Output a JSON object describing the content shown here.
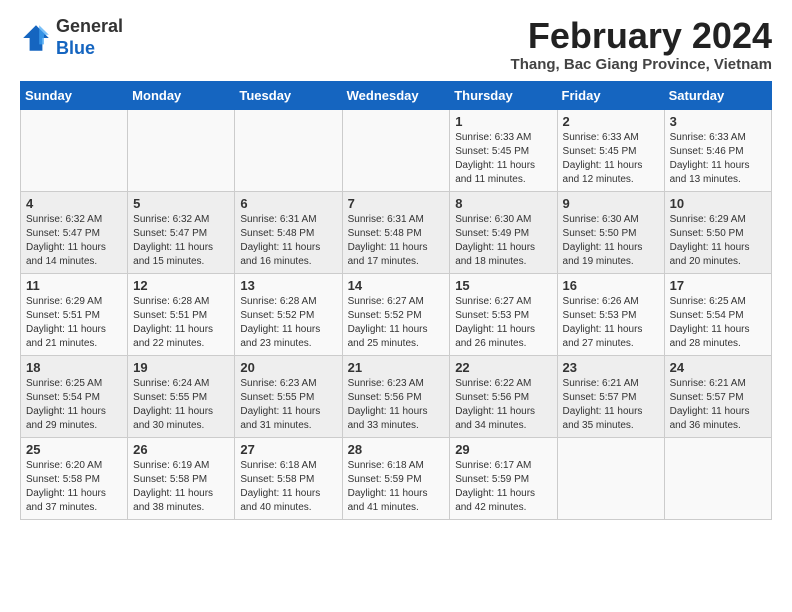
{
  "header": {
    "logo_general": "General",
    "logo_blue": "Blue",
    "month_year": "February 2024",
    "location": "Thang, Bac Giang Province, Vietnam"
  },
  "days_of_week": [
    "Sunday",
    "Monday",
    "Tuesday",
    "Wednesday",
    "Thursday",
    "Friday",
    "Saturday"
  ],
  "weeks": [
    [
      {
        "day": "",
        "info": ""
      },
      {
        "day": "",
        "info": ""
      },
      {
        "day": "",
        "info": ""
      },
      {
        "day": "",
        "info": ""
      },
      {
        "day": "1",
        "info": "Sunrise: 6:33 AM\nSunset: 5:45 PM\nDaylight: 11 hours and 11 minutes."
      },
      {
        "day": "2",
        "info": "Sunrise: 6:33 AM\nSunset: 5:45 PM\nDaylight: 11 hours and 12 minutes."
      },
      {
        "day": "3",
        "info": "Sunrise: 6:33 AM\nSunset: 5:46 PM\nDaylight: 11 hours and 13 minutes."
      }
    ],
    [
      {
        "day": "4",
        "info": "Sunrise: 6:32 AM\nSunset: 5:47 PM\nDaylight: 11 hours and 14 minutes."
      },
      {
        "day": "5",
        "info": "Sunrise: 6:32 AM\nSunset: 5:47 PM\nDaylight: 11 hours and 15 minutes."
      },
      {
        "day": "6",
        "info": "Sunrise: 6:31 AM\nSunset: 5:48 PM\nDaylight: 11 hours and 16 minutes."
      },
      {
        "day": "7",
        "info": "Sunrise: 6:31 AM\nSunset: 5:48 PM\nDaylight: 11 hours and 17 minutes."
      },
      {
        "day": "8",
        "info": "Sunrise: 6:30 AM\nSunset: 5:49 PM\nDaylight: 11 hours and 18 minutes."
      },
      {
        "day": "9",
        "info": "Sunrise: 6:30 AM\nSunset: 5:50 PM\nDaylight: 11 hours and 19 minutes."
      },
      {
        "day": "10",
        "info": "Sunrise: 6:29 AM\nSunset: 5:50 PM\nDaylight: 11 hours and 20 minutes."
      }
    ],
    [
      {
        "day": "11",
        "info": "Sunrise: 6:29 AM\nSunset: 5:51 PM\nDaylight: 11 hours and 21 minutes."
      },
      {
        "day": "12",
        "info": "Sunrise: 6:28 AM\nSunset: 5:51 PM\nDaylight: 11 hours and 22 minutes."
      },
      {
        "day": "13",
        "info": "Sunrise: 6:28 AM\nSunset: 5:52 PM\nDaylight: 11 hours and 23 minutes."
      },
      {
        "day": "14",
        "info": "Sunrise: 6:27 AM\nSunset: 5:52 PM\nDaylight: 11 hours and 25 minutes."
      },
      {
        "day": "15",
        "info": "Sunrise: 6:27 AM\nSunset: 5:53 PM\nDaylight: 11 hours and 26 minutes."
      },
      {
        "day": "16",
        "info": "Sunrise: 6:26 AM\nSunset: 5:53 PM\nDaylight: 11 hours and 27 minutes."
      },
      {
        "day": "17",
        "info": "Sunrise: 6:25 AM\nSunset: 5:54 PM\nDaylight: 11 hours and 28 minutes."
      }
    ],
    [
      {
        "day": "18",
        "info": "Sunrise: 6:25 AM\nSunset: 5:54 PM\nDaylight: 11 hours and 29 minutes."
      },
      {
        "day": "19",
        "info": "Sunrise: 6:24 AM\nSunset: 5:55 PM\nDaylight: 11 hours and 30 minutes."
      },
      {
        "day": "20",
        "info": "Sunrise: 6:23 AM\nSunset: 5:55 PM\nDaylight: 11 hours and 31 minutes."
      },
      {
        "day": "21",
        "info": "Sunrise: 6:23 AM\nSunset: 5:56 PM\nDaylight: 11 hours and 33 minutes."
      },
      {
        "day": "22",
        "info": "Sunrise: 6:22 AM\nSunset: 5:56 PM\nDaylight: 11 hours and 34 minutes."
      },
      {
        "day": "23",
        "info": "Sunrise: 6:21 AM\nSunset: 5:57 PM\nDaylight: 11 hours and 35 minutes."
      },
      {
        "day": "24",
        "info": "Sunrise: 6:21 AM\nSunset: 5:57 PM\nDaylight: 11 hours and 36 minutes."
      }
    ],
    [
      {
        "day": "25",
        "info": "Sunrise: 6:20 AM\nSunset: 5:58 PM\nDaylight: 11 hours and 37 minutes."
      },
      {
        "day": "26",
        "info": "Sunrise: 6:19 AM\nSunset: 5:58 PM\nDaylight: 11 hours and 38 minutes."
      },
      {
        "day": "27",
        "info": "Sunrise: 6:18 AM\nSunset: 5:58 PM\nDaylight: 11 hours and 40 minutes."
      },
      {
        "day": "28",
        "info": "Sunrise: 6:18 AM\nSunset: 5:59 PM\nDaylight: 11 hours and 41 minutes."
      },
      {
        "day": "29",
        "info": "Sunrise: 6:17 AM\nSunset: 5:59 PM\nDaylight: 11 hours and 42 minutes."
      },
      {
        "day": "",
        "info": ""
      },
      {
        "day": "",
        "info": ""
      }
    ]
  ]
}
